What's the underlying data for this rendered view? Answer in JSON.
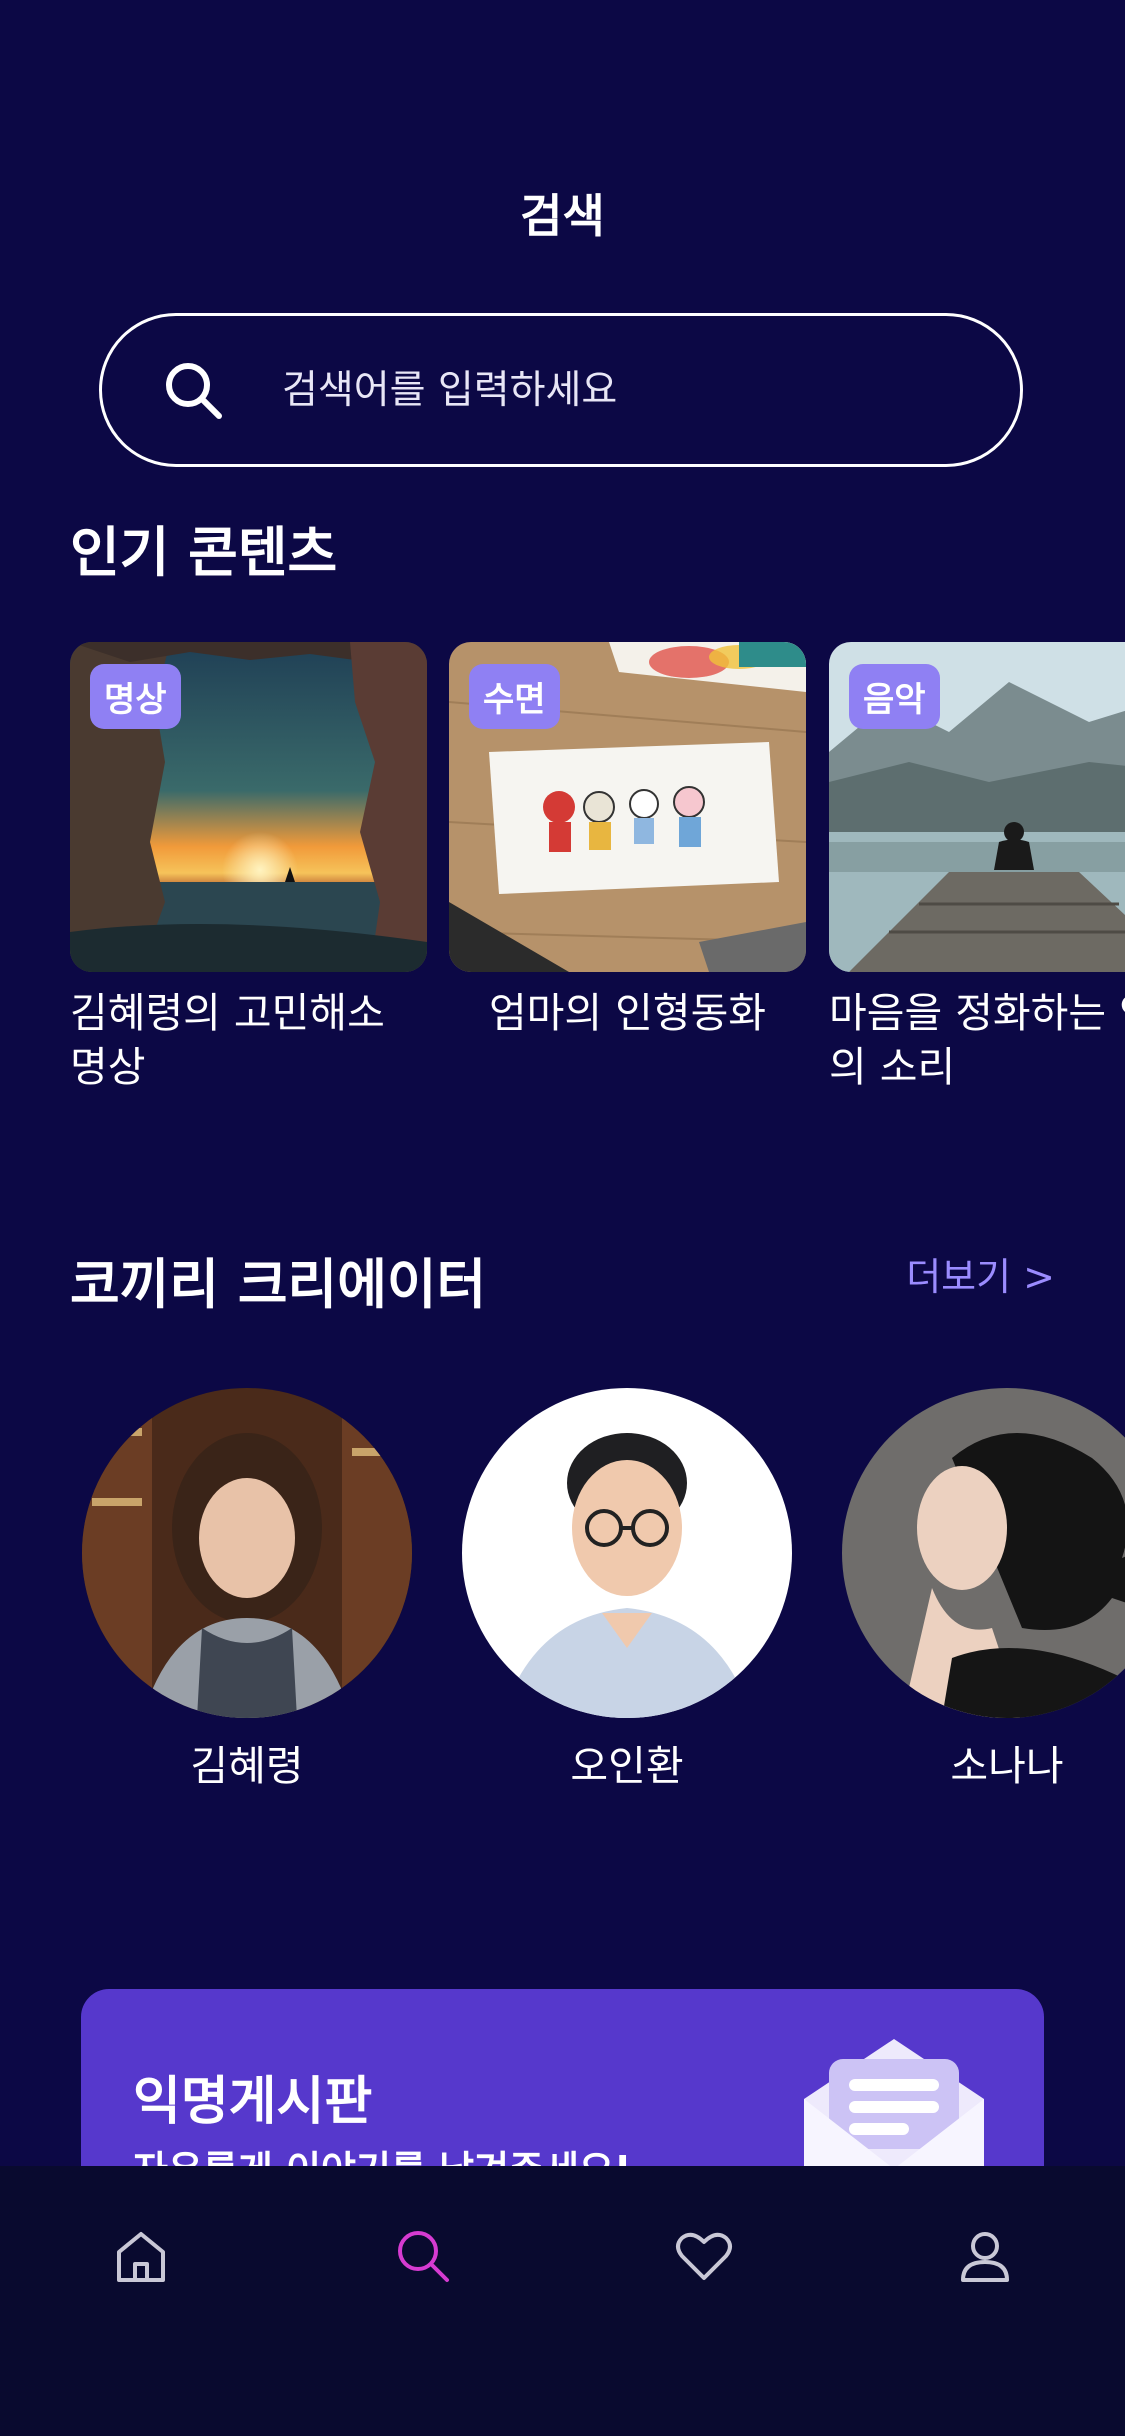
{
  "header": {
    "title": "검색"
  },
  "search": {
    "placeholder": "검색어를 입력하세요",
    "icon": "search-icon"
  },
  "popular": {
    "title": "인기 콘텐츠",
    "items": [
      {
        "tag": "명상",
        "title": "김혜령의 고민해소 명상"
      },
      {
        "tag": "수면",
        "title": "엄마의 인형동화"
      },
      {
        "tag": "음악",
        "title": "마음을 정화하는 연의 소리"
      }
    ]
  },
  "creators": {
    "title": "코끼리 크리에이터",
    "more": "더보기 >",
    "items": [
      {
        "name": "김혜령"
      },
      {
        "name": "오인환"
      },
      {
        "name": "소나나"
      }
    ]
  },
  "banner": {
    "title": "익명게시판",
    "subtitle": "자유롭게 이야기를 남겨주세요!"
  },
  "tabbar": {
    "items": [
      {
        "icon": "home-icon"
      },
      {
        "icon": "search-icon",
        "active": true
      },
      {
        "icon": "heart-icon"
      },
      {
        "icon": "profile-icon"
      }
    ],
    "active_color": "#d63bd1",
    "inactive_color": "#c9c8d6"
  },
  "colors": {
    "background": "#0c0845",
    "accent": "#9b8cff",
    "tag": "#8f80f3",
    "banner": "#5638cc"
  }
}
